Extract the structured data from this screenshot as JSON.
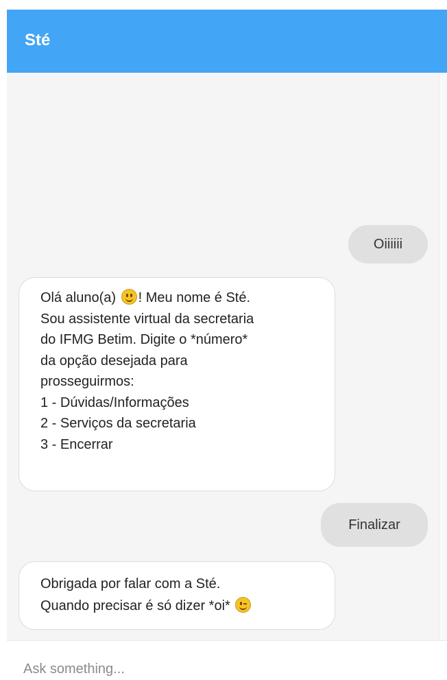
{
  "header": {
    "title": "Sté"
  },
  "messages": [
    {
      "sender": "user",
      "text": "Oiiiiii"
    },
    {
      "sender": "bot",
      "lines": [
        {
          "before": "Olá aluno(a) ",
          "emoji": "smile-emoji",
          "after": "! Meu nome é Sté."
        },
        "Sou assistente virtual da secretaria",
        "do IFMG Betim. Digite o *número*",
        "da opção desejada para",
        "prosseguirmos:",
        "1 - Dúvidas/Informações",
        "2 - Serviços da secretaria",
        "3 - Encerrar"
      ]
    },
    {
      "sender": "user",
      "text": "Finalizar"
    },
    {
      "sender": "bot",
      "lines": [
        "Obrigada por falar com a Sté.",
        {
          "before": "Quando precisar é só dizer *oi* ",
          "emoji": "wink-emoji",
          "after": ""
        }
      ]
    }
  ],
  "input": {
    "placeholder": "Ask something..."
  },
  "colors": {
    "header": "#42a5f5",
    "chat_background": "#f5f5f5",
    "user_bubble": "#e0e0e0",
    "bot_bubble": "#ffffff",
    "emoji": "#f7c325"
  }
}
